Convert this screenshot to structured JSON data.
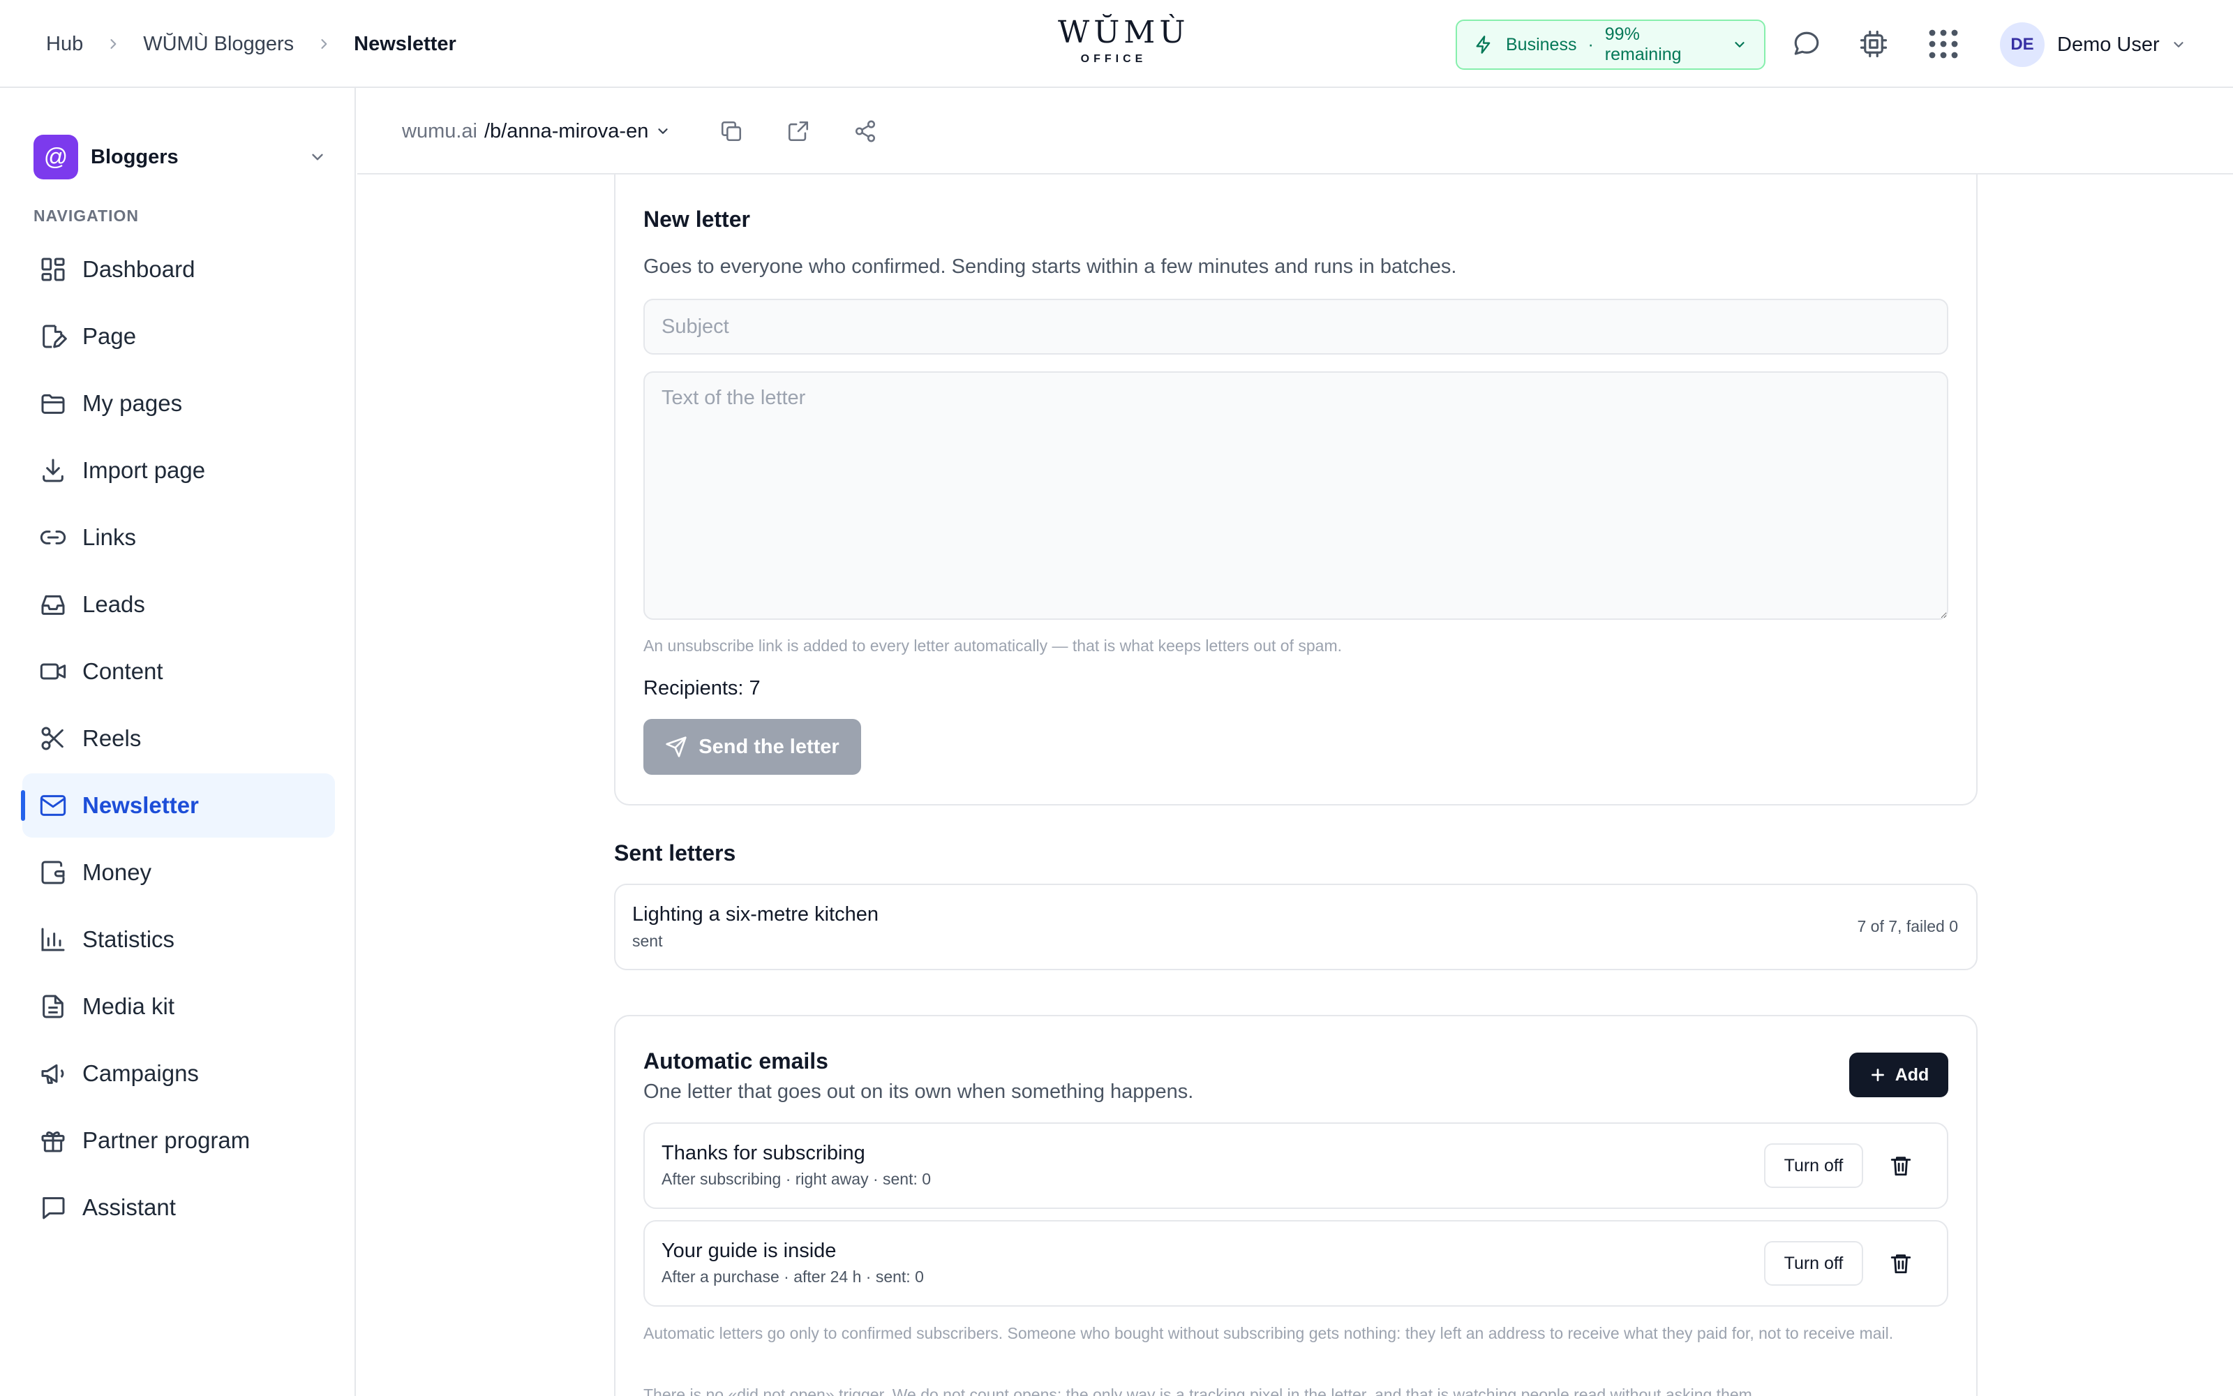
{
  "breadcrumb": [
    "Hub",
    "WŬMÙ Bloggers",
    "Newsletter"
  ],
  "logo": {
    "main": "WŬMÙ",
    "sub": "OFFICE"
  },
  "plan": {
    "name": "Business",
    "separator": "·",
    "remaining": "99% remaining",
    "icon": "lightning-icon"
  },
  "header_icons": [
    "chat-bubble-icon",
    "chip-icon",
    "apps-grid-icon"
  ],
  "user": {
    "initials": "DE",
    "name": "Demo User"
  },
  "workspace": {
    "icon": "@",
    "name": "Bloggers"
  },
  "nav_title": "NAVIGATION",
  "nav": [
    {
      "label": "Dashboard",
      "icon": "dashboard-icon"
    },
    {
      "label": "Page",
      "icon": "page-edit-icon"
    },
    {
      "label": "My pages",
      "icon": "folder-icon"
    },
    {
      "label": "Import page",
      "icon": "download-icon"
    },
    {
      "label": "Links",
      "icon": "link-icon"
    },
    {
      "label": "Leads",
      "icon": "inbox-icon"
    },
    {
      "label": "Content",
      "icon": "video-icon"
    },
    {
      "label": "Reels",
      "icon": "scissors-icon"
    },
    {
      "label": "Newsletter",
      "icon": "mail-icon",
      "active": true
    },
    {
      "label": "Money",
      "icon": "wallet-icon"
    },
    {
      "label": "Statistics",
      "icon": "bar-chart-icon"
    },
    {
      "label": "Media kit",
      "icon": "document-icon"
    },
    {
      "label": "Campaigns",
      "icon": "megaphone-icon"
    },
    {
      "label": "Partner program",
      "icon": "gift-icon"
    },
    {
      "label": "Assistant",
      "icon": "message-icon"
    }
  ],
  "url": {
    "host": "wumu.ai",
    "path": "/b/anna-mirova-en"
  },
  "new_letter": {
    "title": "New letter",
    "description": "Goes to everyone who confirmed. Sending starts within a few minutes and runs in batches.",
    "subject_placeholder": "Subject",
    "body_placeholder": "Text of the letter",
    "hint": "An unsubscribe link is added to every letter automatically — that is what keeps letters out of spam.",
    "recipients": "Recipients: 7",
    "send_label": "Send the letter"
  },
  "sent": {
    "title": "Sent letters",
    "items": [
      {
        "title": "Lighting a six-metre kitchen",
        "status": "sent",
        "stats": "7 of 7, failed 0"
      }
    ]
  },
  "automatic": {
    "title": "Automatic emails",
    "description": "One letter that goes out on its own when something happens.",
    "add_label": "Add",
    "items": [
      {
        "title": "Thanks for subscribing",
        "meta": "After subscribing · right away · sent: 0",
        "toggle_label": "Turn off"
      },
      {
        "title": "Your guide is inside",
        "meta": "After a purchase · after 24 h · sent: 0",
        "toggle_label": "Turn off"
      }
    ],
    "note1": "Automatic letters go only to confirmed subscribers. Someone who bought without subscribing gets nothing: they left an address to receive what they paid for, not to receive mail.",
    "note2": "There is no «did not open» trigger. We do not count opens: the only way is a tracking pixel in the letter, and that is watching people read without asking them."
  },
  "colors": {
    "accent": "#2563eb",
    "badge_bg": "#ecfdf5",
    "badge_text": "#047857",
    "workspace": "#7c3aed",
    "dark_button": "#111827"
  }
}
